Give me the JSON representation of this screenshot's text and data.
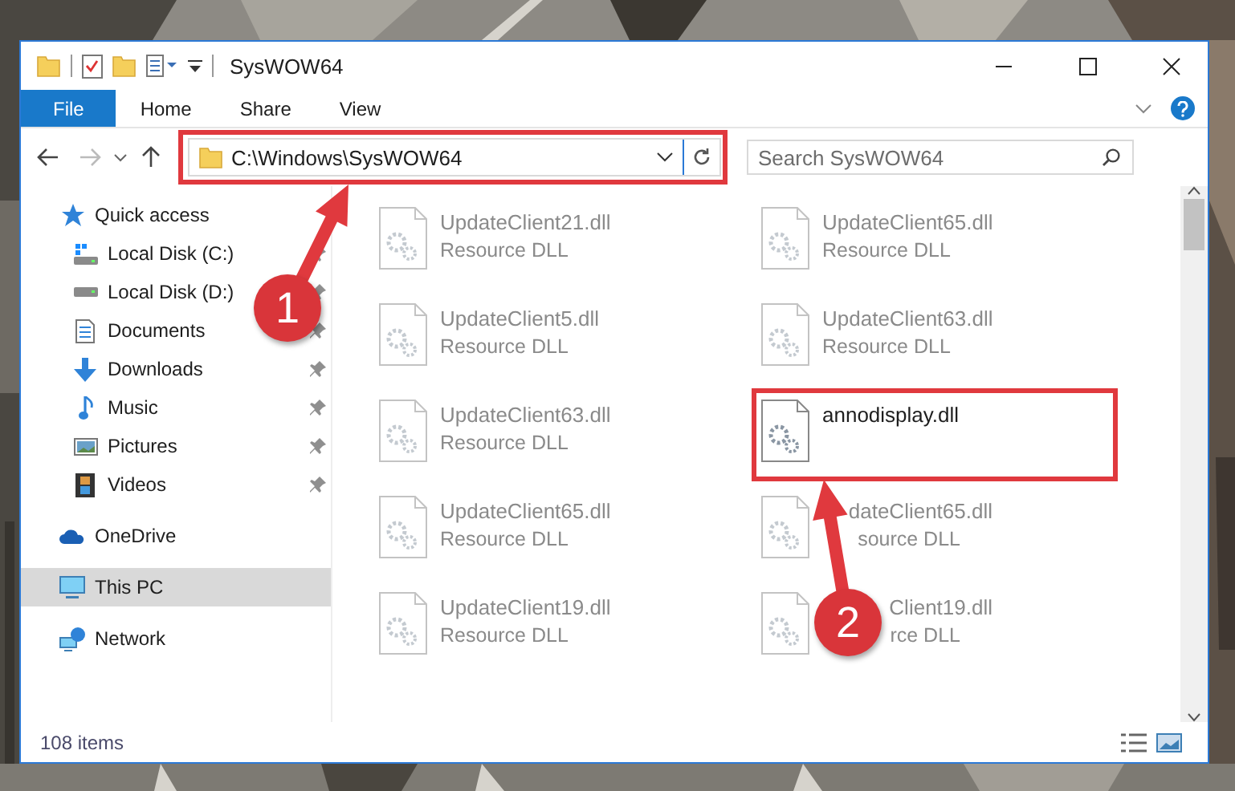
{
  "window": {
    "title": "SysWOW64"
  },
  "ribbon": {
    "tabs": [
      {
        "label": "File",
        "kind": "file"
      },
      {
        "label": "Home",
        "kind": "tab"
      },
      {
        "label": "Share",
        "kind": "tab"
      },
      {
        "label": "View",
        "kind": "tab"
      }
    ]
  },
  "address": {
    "path": "C:\\Windows\\SysWOW64"
  },
  "search": {
    "placeholder": "Search SysWOW64"
  },
  "navigation": [
    {
      "label": "Quick access",
      "kind": "star",
      "selected": false,
      "children": [
        {
          "label": "Local Disk (C:)",
          "kind": "disk-c",
          "pinned": true,
          "selected": false
        },
        {
          "label": "Local Disk (D:)",
          "kind": "disk",
          "pinned": true,
          "selected": false
        },
        {
          "label": "Documents",
          "kind": "documents",
          "pinned": true,
          "selected": false
        },
        {
          "label": "Downloads",
          "kind": "downloads",
          "pinned": true,
          "selected": false
        },
        {
          "label": "Music",
          "kind": "music",
          "pinned": true,
          "selected": false
        },
        {
          "label": "Pictures",
          "kind": "pictures",
          "pinned": true,
          "selected": false
        },
        {
          "label": "Videos",
          "kind": "videos",
          "pinned": true,
          "selected": false
        }
      ]
    },
    {
      "label": "OneDrive",
      "kind": "cloud",
      "selected": false
    },
    {
      "label": "This PC",
      "kind": "pc",
      "selected": true
    },
    {
      "label": "Network",
      "kind": "network",
      "selected": false
    }
  ],
  "files": [
    {
      "name": "UpdateClient21.dll",
      "type": "Resource DLL",
      "blurred": true,
      "covered": false,
      "highlighted": false
    },
    {
      "name": "UpdateClient65.dll",
      "type": "Resource DLL",
      "blurred": true,
      "covered": false,
      "highlighted": false
    },
    {
      "name": "UpdateClient5.dll",
      "type": "Resource DLL",
      "blurred": true,
      "covered": false,
      "highlighted": false
    },
    {
      "name": "UpdateClient63.dll",
      "type": "Resource DLL",
      "blurred": true,
      "covered": false,
      "highlighted": false
    },
    {
      "name": "UpdateClient63.dll",
      "type": "Resource DLL",
      "blurred": true,
      "covered": false,
      "highlighted": false
    },
    {
      "name": "annodisplay.dll",
      "blurred": false,
      "covered": false,
      "highlighted": true
    },
    {
      "name": "UpdateClient65.dll",
      "type": "Resource DLL",
      "blurred": true,
      "covered": false,
      "highlighted": false
    },
    {
      "name": "dateClient65.dll",
      "type": "source DLL",
      "blurred": true,
      "covered": true,
      "highlighted": false
    },
    {
      "name": "UpdateClient19.dll",
      "type": "Resource DLL",
      "blurred": true,
      "covered": false,
      "highlighted": false
    },
    {
      "name": "Client19.dll",
      "type": "rce DLL",
      "blurred": true,
      "covered": true,
      "highlighted": false
    }
  ],
  "status_bar": {
    "count": "108 items"
  },
  "callouts": [
    {
      "number": "1"
    },
    {
      "number": "2"
    }
  ]
}
